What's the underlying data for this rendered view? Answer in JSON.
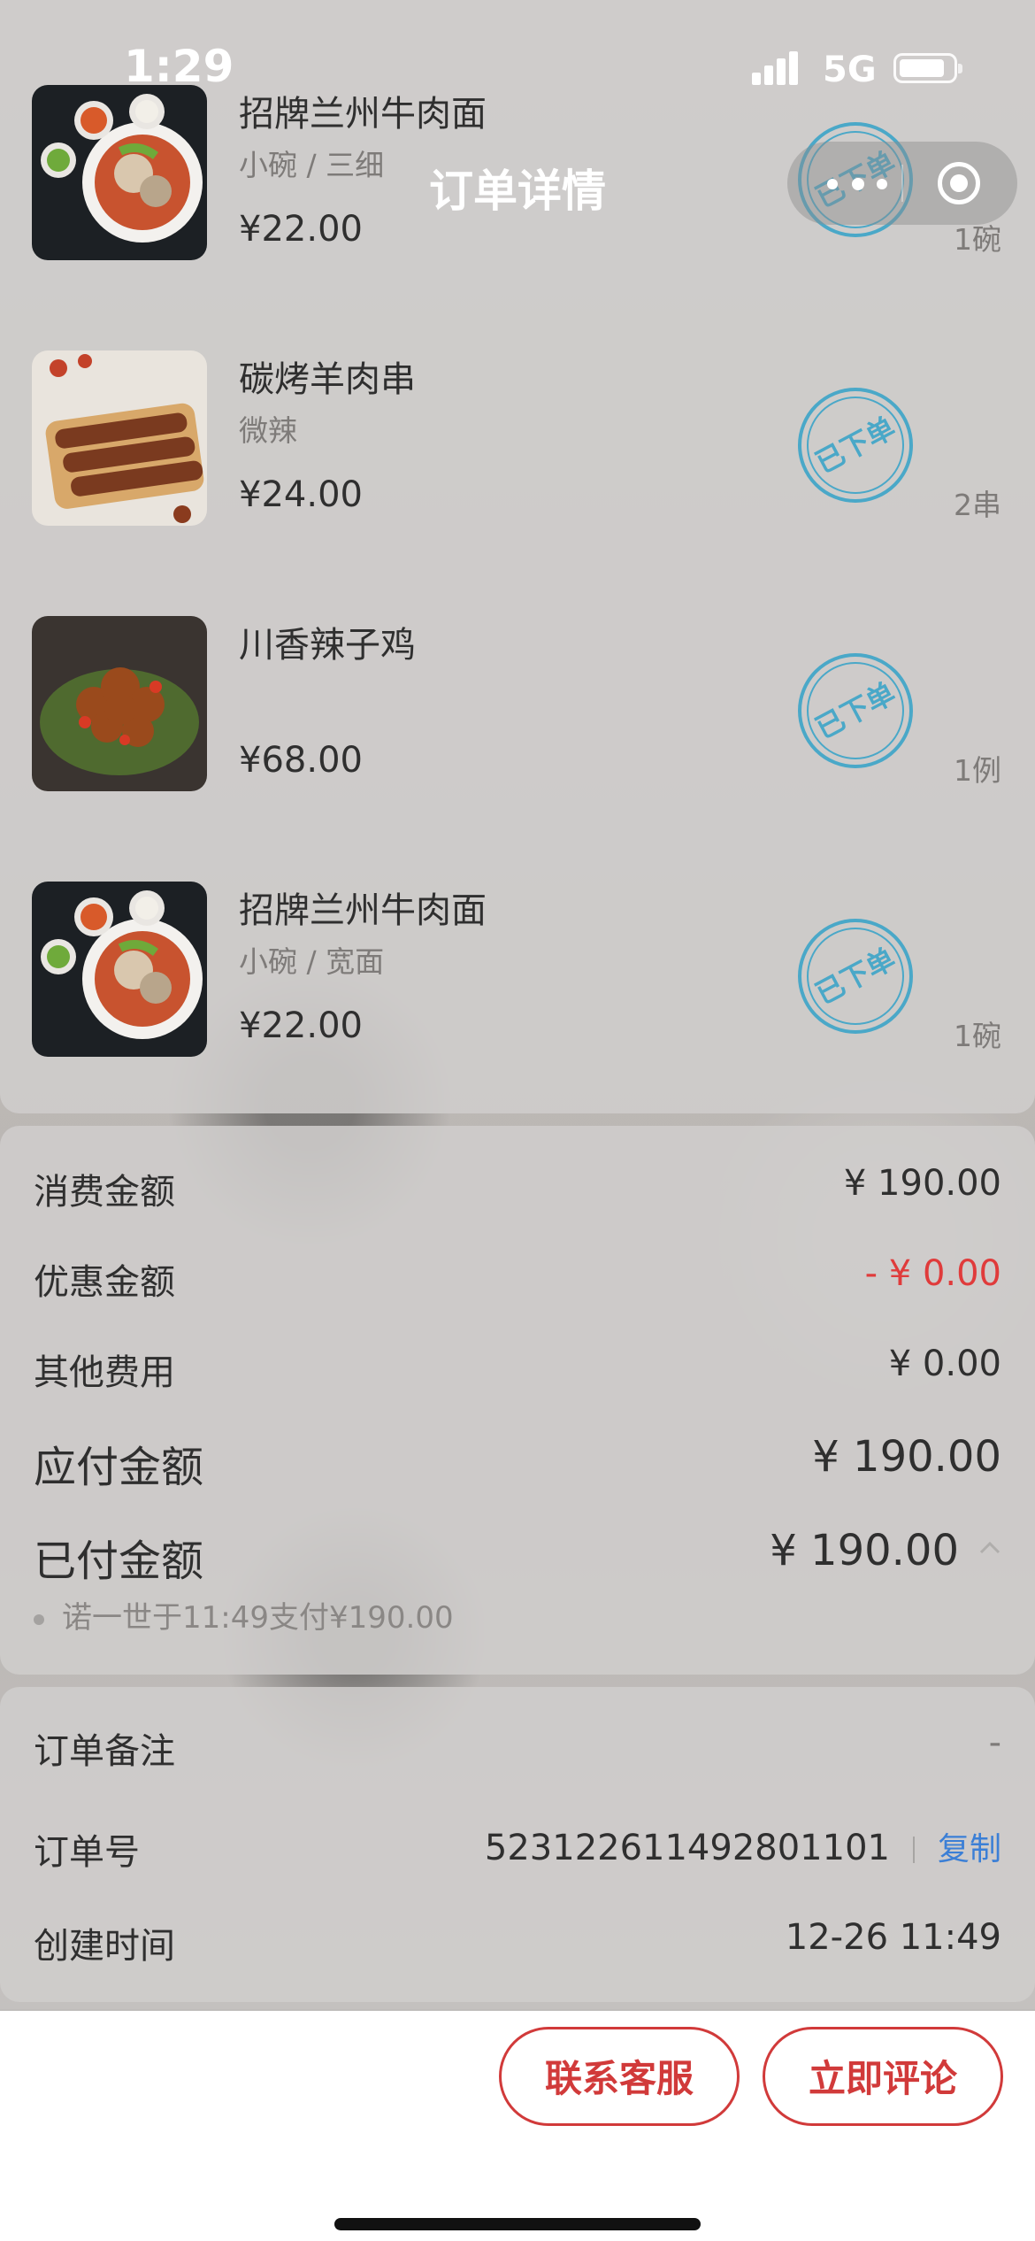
{
  "status_bar": {
    "time": "1:29",
    "network": "5G"
  },
  "nav": {
    "title": "订单详情"
  },
  "items": [
    {
      "name": "招牌兰州牛肉面",
      "spec": "小碗 / 三细",
      "price": "¥22.00",
      "qty": "1碗",
      "stamp": "已下单"
    },
    {
      "name": "碳烤羊肉串",
      "spec": "微辣",
      "price": "¥24.00",
      "qty": "2串",
      "stamp": "已下单"
    },
    {
      "name": "川香辣子鸡",
      "spec": "",
      "price": "¥68.00",
      "qty": "1例",
      "stamp": "已下单"
    },
    {
      "name": "招牌兰州牛肉面",
      "spec": "小碗 / 宽面",
      "price": "¥22.00",
      "qty": "1碗",
      "stamp": "已下单"
    }
  ],
  "summary": {
    "consumption": {
      "label": "消费金额",
      "value": "¥ 190.00"
    },
    "discount": {
      "label": "优惠金额",
      "value": "- ¥ 0.00"
    },
    "other": {
      "label": "其他费用",
      "value": "¥ 0.00"
    },
    "payable": {
      "label": "应付金额",
      "value": "¥ 190.00"
    },
    "paid": {
      "label": "已付金额",
      "value": "¥ 190.00"
    },
    "payment_record": "诺一世于11:49支付¥190.00"
  },
  "info": {
    "remark": {
      "label": "订单备注",
      "value": "-"
    },
    "order_no": {
      "label": "订单号",
      "value": "523122611492801101",
      "copy_label": "复制"
    },
    "created": {
      "label": "创建时间",
      "value": "12-26 11:49"
    }
  },
  "actions": {
    "contact": "联系客服",
    "review": "立即评论"
  },
  "colors": {
    "accent_red": "#d13a3a",
    "stamp_blue": "#4aa8c8",
    "link_blue": "#3b7fd6"
  }
}
